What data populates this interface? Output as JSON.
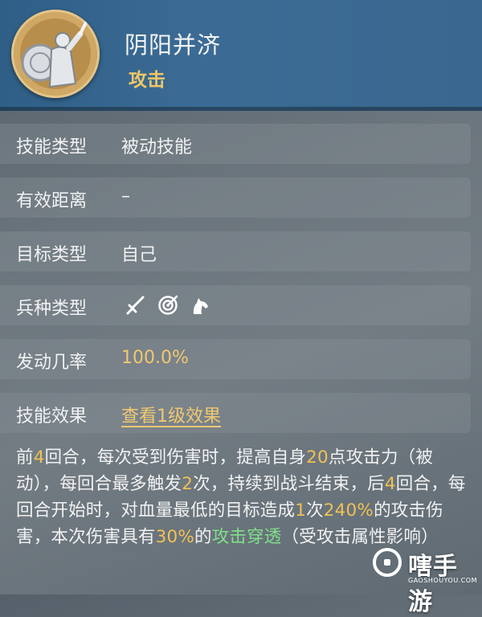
{
  "header": {
    "skill_name": "阴阳并济",
    "skill_type": "攻击"
  },
  "rows": [
    {
      "label": "技能类型",
      "value": "被动技能"
    },
    {
      "label": "有效距离",
      "value": "–"
    },
    {
      "label": "目标类型",
      "value": "自己"
    },
    {
      "label": "兵种类型",
      "icons": [
        "sword-icon",
        "target-icon",
        "horse-icon"
      ]
    },
    {
      "label": "发动几率",
      "value": "100.0%"
    },
    {
      "label": "技能效果",
      "value": "查看1级效果"
    }
  ],
  "description": {
    "p1": "前",
    "n1": "4",
    "p2": "回合，每次受到伤害时，提高自身",
    "n2": "20",
    "p3": "点攻击力（被动），每回合最多触发",
    "n3": "2",
    "p4": "次，持续到战斗结束，后",
    "n4": "4",
    "p5": "回合，每回合开始时，对血量最低的目标造成",
    "n5": "1",
    "p6": "次",
    "n6": "240%",
    "p7": "的攻击伤害，本次伤害具有",
    "n7": "30%",
    "p8": "的",
    "g1": "攻击穿透",
    "p9": "（受攻击属性影响）"
  },
  "watermark": {
    "name": "嗐手游",
    "url": "GAOSHOUYOU.COM"
  },
  "colors": {
    "header_bg": "#3b6b94",
    "skill_type": "#f1c667",
    "highlight_gold": "#f0c155",
    "highlight_green": "#7fe08a"
  }
}
